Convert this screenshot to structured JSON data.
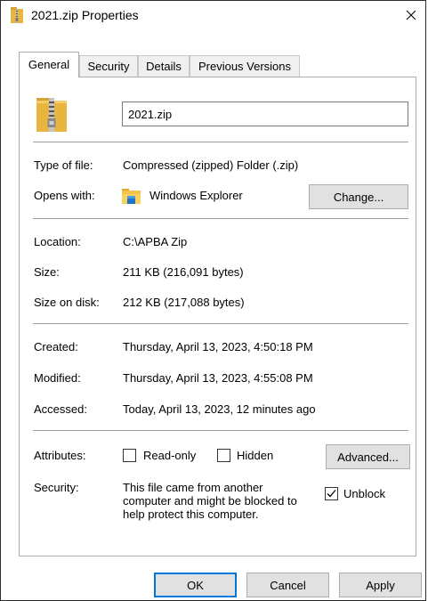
{
  "window": {
    "title": "2021.zip Properties"
  },
  "tabs": [
    {
      "label": "General",
      "active": true
    },
    {
      "label": "Security",
      "active": false
    },
    {
      "label": "Details",
      "active": false
    },
    {
      "label": "Previous Versions",
      "active": false
    }
  ],
  "general": {
    "file_name": "2021.zip",
    "type_label": "Type of file:",
    "type_value": "Compressed (zipped) Folder (.zip)",
    "opens_label": "Opens with:",
    "opens_value": "Windows Explorer",
    "change_button": "Change...",
    "location_label": "Location:",
    "location_value": "C:\\APBA Zip",
    "size_label": "Size:",
    "size_value": "211 KB (216,091 bytes)",
    "size_on_disk_label": "Size on disk:",
    "size_on_disk_value": "212 KB (217,088 bytes)",
    "created_label": "Created:",
    "created_value": "Thursday, April 13, 2023, 4:50:18 PM",
    "modified_label": "Modified:",
    "modified_value": "Thursday, April 13, 2023, 4:55:08 PM",
    "accessed_label": "Accessed:",
    "accessed_value": "Today, April 13, 2023, 12 minutes ago",
    "attributes_label": "Attributes:",
    "readonly_label": "Read-only",
    "readonly_checked": false,
    "hidden_label": "Hidden",
    "hidden_checked": false,
    "advanced_button": "Advanced...",
    "security_label": "Security:",
    "security_line1": "This file came from another",
    "security_line2": "computer and might be blocked to",
    "security_line3": "help protect this computer.",
    "unblock_label": "Unblock",
    "unblock_checked": true
  },
  "footer": {
    "ok": "OK",
    "cancel": "Cancel",
    "apply": "Apply"
  },
  "icons": {
    "title": "zip-folder-icon",
    "file": "zip-folder-icon",
    "opens_with": "file-explorer-icon",
    "close": "close-icon",
    "checkmark": "checkmark-icon"
  },
  "colors": {
    "default_button_border": "#0078d7",
    "folder_yellow": "#e8b640"
  }
}
